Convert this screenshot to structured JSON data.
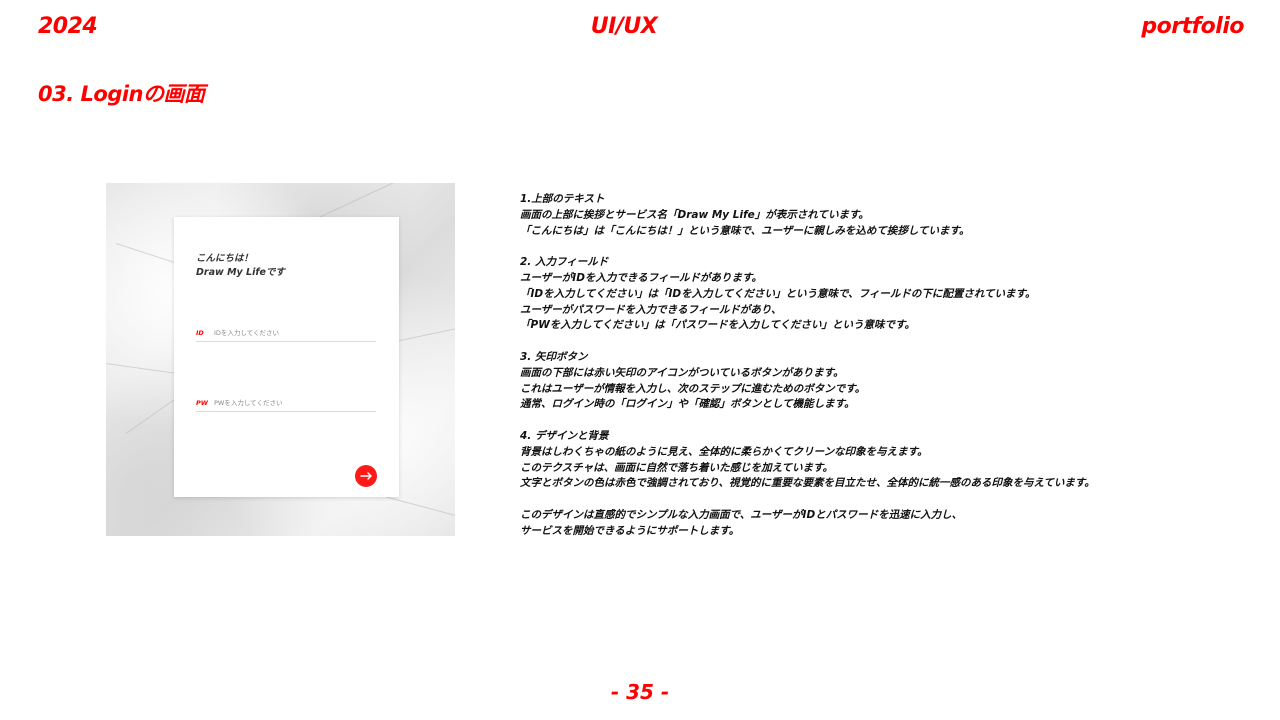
{
  "header": {
    "year": "2024",
    "category": "UI/UX",
    "label": "portfolio"
  },
  "section_title": "03. Loginの画面",
  "mockup": {
    "greeting_line1": "こんにちは！",
    "greeting_line2": "Draw My Lifeです",
    "id_label": "ID",
    "id_placeholder": "IDを入力してください",
    "pw_label": "PW",
    "pw_placeholder": "PWを入力してください",
    "submit_icon": "arrow-right-icon",
    "accent_color": "#ff1a1a"
  },
  "description": {
    "block1": [
      "1.上部のテキスト",
      "画面の上部に挨拶とサービス名「Draw My Life」が表示されています。",
      "「こんにちは」は「こんにちは！」という意味で、ユーザーに親しみを込めて挨拶しています。"
    ],
    "block2": [
      "2. 入力フィールド",
      "ユーザーがIDを入力できるフィールドがあります。",
      "「IDを入力してください」は「IDを入力してください」という意味で、フィールドの下に配置されています。",
      "ユーザーがパスワードを入力できるフィールドがあり、",
      "「PWを入力してください」は「パスワードを入力してください」という意味です。"
    ],
    "block3": [
      "3. 矢印ボタン",
      "画面の下部には赤い矢印のアイコンがついているボタンがあります。",
      "これはユーザーが情報を入力し、次のステップに進むためのボタンです。",
      "通常、ログイン時の「ログイン」や「確認」ボタンとして機能します。"
    ],
    "block4": [
      "4. デザインと背景",
      "背景はしわくちゃの紙のように見え、全体的に柔らかくてクリーンな印象を与えます。",
      "このテクスチャは、画面に自然で落ち着いた感じを加えています。",
      "文字とボタンの色は赤色で強調されており、視覚的に重要な要素を目立たせ、全体的に統一感のある印象を与えています。"
    ],
    "block5": [
      "このデザインは直感的でシンプルな入力画面で、ユーザーがIDとパスワードを迅速に入力し、",
      "サービスを開始できるようにサポートします。"
    ]
  },
  "page_number": "- 35 -",
  "colors": {
    "accent": "#ff0000",
    "text": "#111111"
  }
}
